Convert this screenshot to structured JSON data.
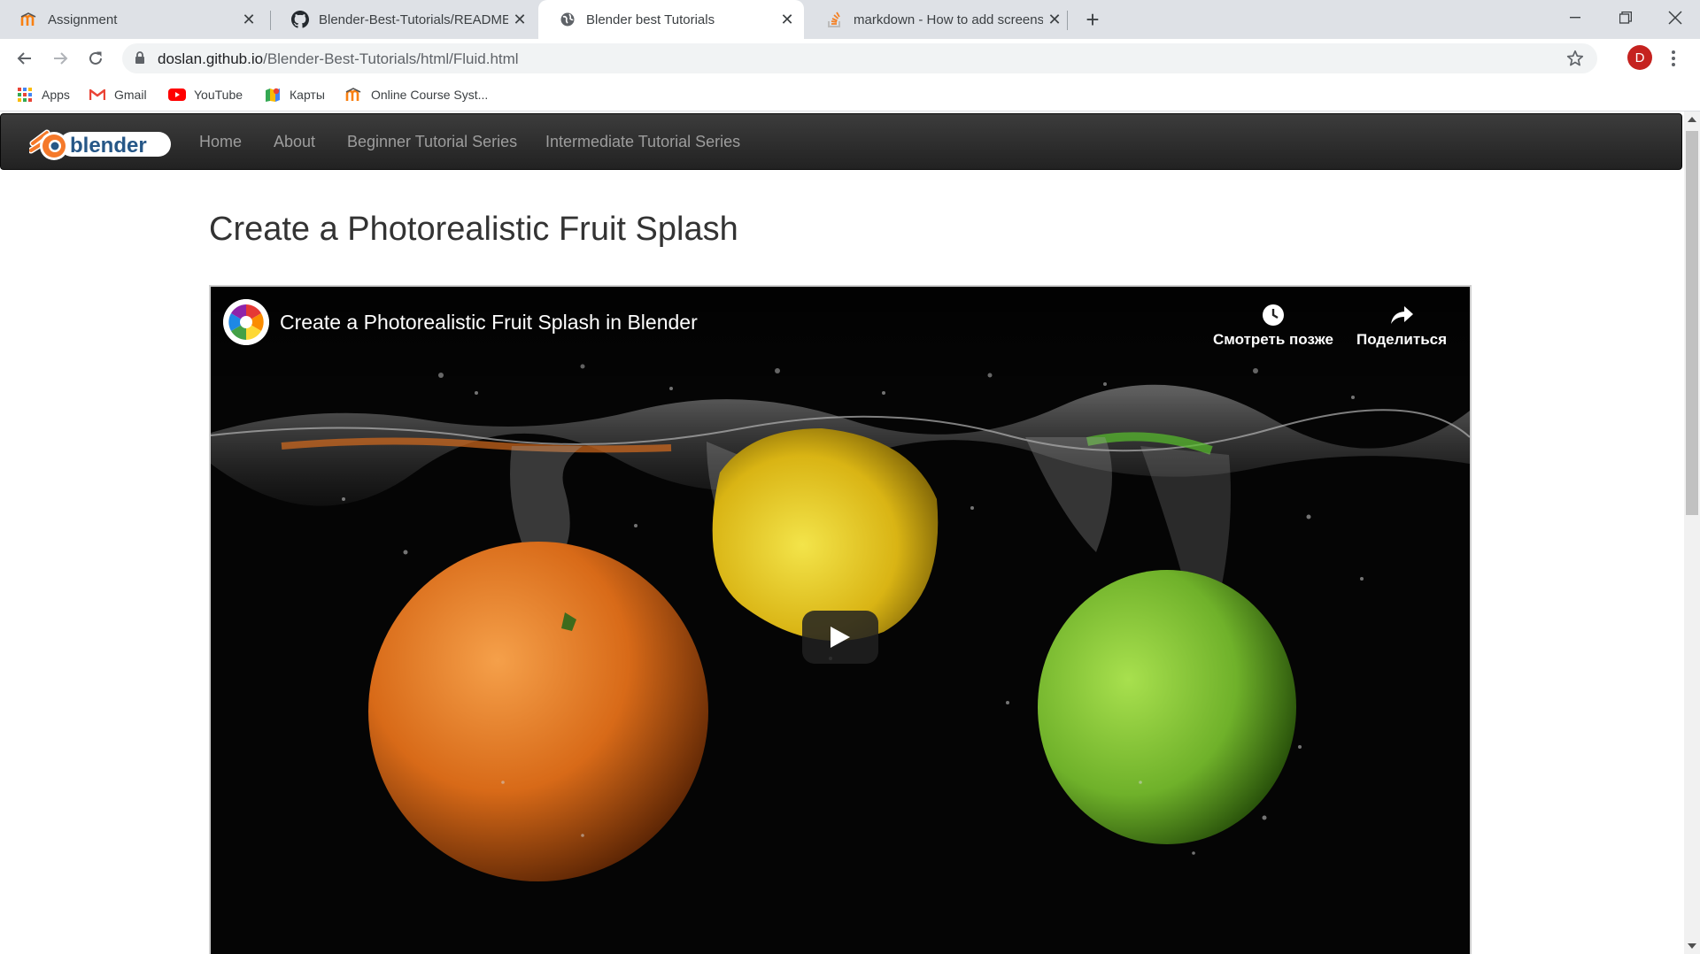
{
  "browser": {
    "tabs": [
      {
        "title": "Assignment",
        "icon": "moodle-icon",
        "active": false
      },
      {
        "title": "Blender-Best-Tutorials/README.md",
        "icon": "github-icon",
        "active": false
      },
      {
        "title": "Blender best Tutorials",
        "icon": "globe-icon",
        "active": true
      },
      {
        "title": "markdown - How to add screenshot",
        "icon": "stackoverflow-icon",
        "active": false
      }
    ],
    "new_tab": "+",
    "url_host": "doslan.github.io",
    "url_path": "/Blender-Best-Tutorials/html/Fluid.html",
    "profile_initial": "D",
    "profile_color": "#c5221f",
    "bookmarks": [
      {
        "label": "Apps",
        "icon": "apps-grid-icon"
      },
      {
        "label": "Gmail",
        "icon": "gmail-icon"
      },
      {
        "label": "YouTube",
        "icon": "youtube-icon"
      },
      {
        "label": "Карты",
        "icon": "maps-icon"
      },
      {
        "label": "Online Course Syst...",
        "icon": "moodle-icon"
      }
    ]
  },
  "site": {
    "logo_text": "blender",
    "nav": [
      "Home",
      "About",
      "Beginner Tutorial Series",
      "Intermediate Tutorial Series"
    ],
    "page_title": "Create a Photorealistic Fruit Splash"
  },
  "video": {
    "title": "Create a Photorealistic Fruit Splash in Blender",
    "watch_later": "Смотреть позже",
    "share": "Поделиться",
    "play_icon": "play-icon"
  },
  "colors": {
    "navbar": "#222222",
    "nav_link": "#9d9d9d",
    "title": "#333333"
  }
}
